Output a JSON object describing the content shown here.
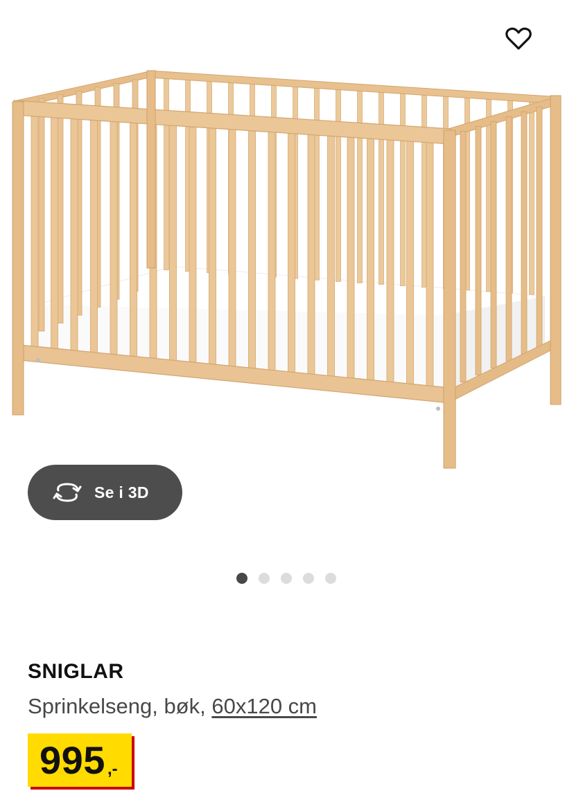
{
  "product": {
    "name": "SNIGLAR",
    "description": "Sprinkelseng, bøk,",
    "size": "60x120 cm",
    "price_integer": "995",
    "price_decimal": ",-"
  },
  "view_3d": {
    "label": "Se i 3D",
    "icon": "rotate-3d-icon"
  },
  "favorite": {
    "icon": "heart-outline-icon"
  },
  "carousel": {
    "total": 5,
    "active_index": 0
  },
  "colors": {
    "price_yellow": "#ffdb00",
    "price_red_shadow": "#cc0008",
    "button_dark": "#4d4d4d",
    "dot_active": "#484848",
    "dot_inactive": "#dcdcdc",
    "wood": "#e9c393",
    "mattress": "#f8f8f8"
  }
}
